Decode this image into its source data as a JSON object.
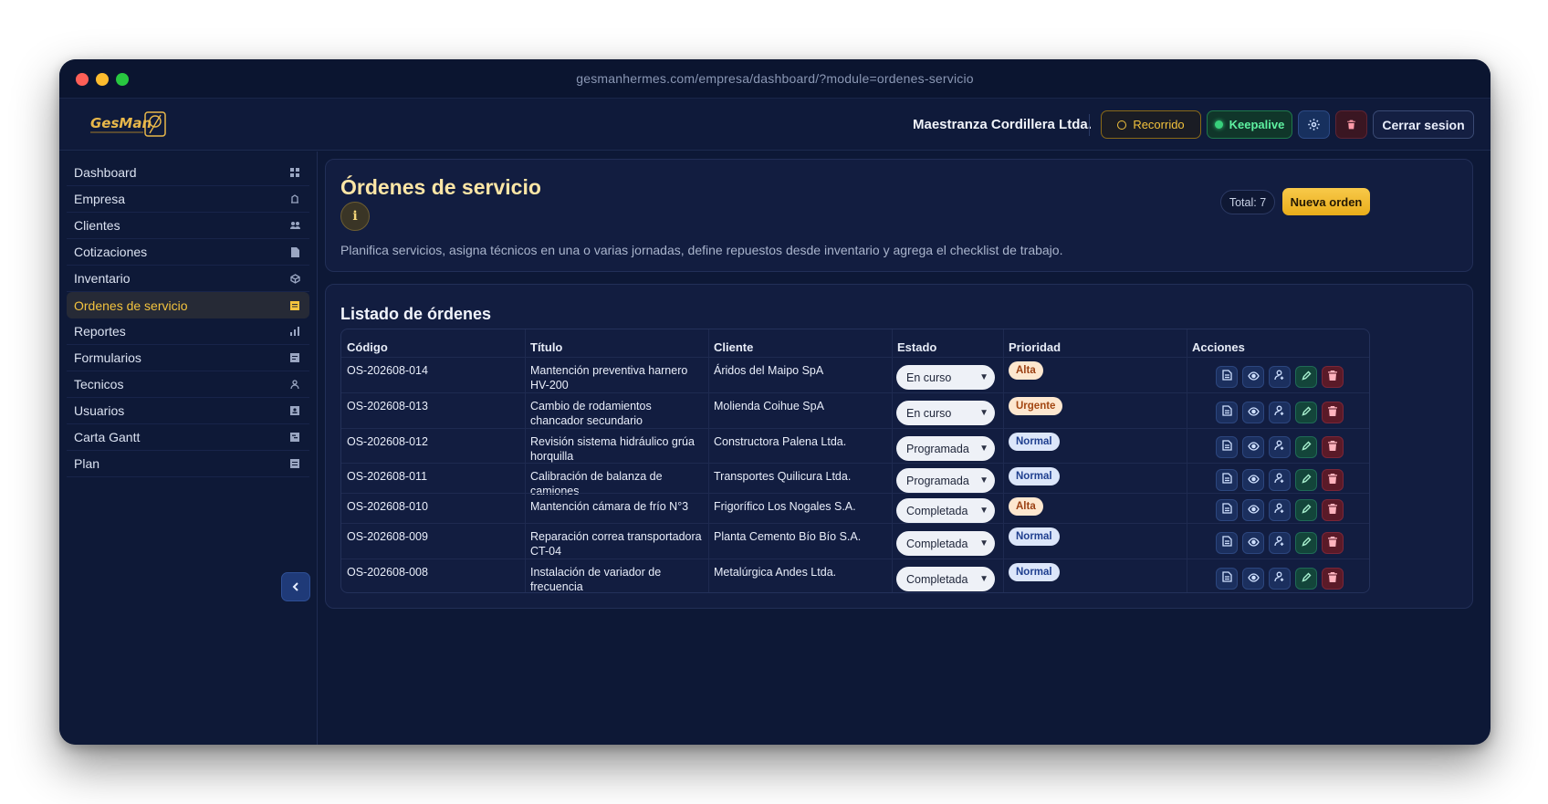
{
  "browser": {
    "url": "gesmanhermes.com/empresa/dashboard/?module=ordenes-servicio"
  },
  "header": {
    "logo_text": "GesMan",
    "company": "Maestranza Cordillera Ltda.",
    "recorrido_label": "Recorrido",
    "keepalive_label": "Keepalive",
    "logout_label": "Cerrar sesion"
  },
  "sidebar": {
    "items": [
      {
        "label": "Dashboard",
        "icon": "grid-icon"
      },
      {
        "label": "Empresa",
        "icon": "building-icon"
      },
      {
        "label": "Clientes",
        "icon": "users-icon"
      },
      {
        "label": "Cotizaciones",
        "icon": "document-icon"
      },
      {
        "label": "Inventario",
        "icon": "box-icon"
      },
      {
        "label": "Ordenes de servicio",
        "icon": "clipboard-icon"
      },
      {
        "label": "Reportes",
        "icon": "bar-chart-icon"
      },
      {
        "label": "Formularios",
        "icon": "form-icon"
      },
      {
        "label": "Tecnicos",
        "icon": "user-icon"
      },
      {
        "label": "Usuarios",
        "icon": "user-card-icon"
      },
      {
        "label": "Carta Gantt",
        "icon": "gantt-icon"
      },
      {
        "label": "Plan",
        "icon": "plan-icon"
      }
    ],
    "active_index": 5
  },
  "main": {
    "title": "Órdenes de servicio",
    "info_label": "i",
    "description": "Planifica servicios, asigna técnicos en una o varias jornadas, define repuestos desde inventario y agrega el checklist de trabajo.",
    "total_label": "Total: 7",
    "new_order_label": "Nueva orden",
    "list_title": "Listado de órdenes",
    "columns": [
      "Código",
      "Título",
      "Cliente",
      "Estado",
      "Prioridad",
      "Acciones"
    ],
    "rows": [
      {
        "code": "OS-202608-014",
        "title": "Mantención preventiva harnero HV-200",
        "client": "Áridos del Maipo SpA",
        "status": "En curso",
        "priority": "Alta"
      },
      {
        "code": "OS-202608-013",
        "title": "Cambio de rodamientos chancador secundario",
        "client": "Molienda Coihue SpA",
        "status": "En curso",
        "priority": "Urgente"
      },
      {
        "code": "OS-202608-012",
        "title": "Revisión sistema hidráulico grúa horquilla",
        "client": "Constructora Palena Ltda.",
        "status": "Programada",
        "priority": "Normal"
      },
      {
        "code": "OS-202608-011",
        "title": "Calibración de balanza de camiones",
        "client": "Transportes Quilicura Ltda.",
        "status": "Programada",
        "priority": "Normal"
      },
      {
        "code": "OS-202608-010",
        "title": "Mantención cámara de frío N°3",
        "client": "Frigorífico Los Nogales S.A.",
        "status": "Completada",
        "priority": "Alta"
      },
      {
        "code": "OS-202608-009",
        "title": "Reparación correa transportadora CT-04",
        "client": "Planta Cemento Bío Bío S.A.",
        "status": "Completada",
        "priority": "Normal"
      },
      {
        "code": "OS-202608-008",
        "title": "Instalación de variador de frecuencia",
        "client": "Metalúrgica Andes Ltda.",
        "status": "Completada",
        "priority": "Normal"
      }
    ]
  },
  "colors": {
    "accent": "#f3c33e",
    "background": "#0d1836",
    "card": "#121d40",
    "danger": "#5a1a28",
    "success": "#13453a"
  }
}
